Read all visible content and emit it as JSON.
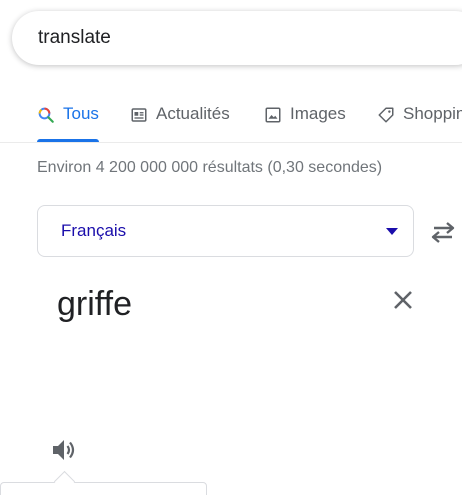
{
  "search": {
    "query": "translate"
  },
  "tabs": [
    {
      "label": "Tous",
      "icon": "search-icon",
      "active": true
    },
    {
      "label": "Actualités",
      "icon": "news-icon",
      "active": false
    },
    {
      "label": "Images",
      "icon": "image-icon",
      "active": false
    },
    {
      "label": "Shopping",
      "icon": "tag-icon",
      "active": false
    }
  ],
  "result_stats": "Environ 4 200 000 000 résultats (0,30 secondes)",
  "translator": {
    "source_language": "Français",
    "source_text": "griffe",
    "icons": {
      "dropdown": "chevron-down-icon",
      "swap": "swap-arrows-icon",
      "clear": "close-icon",
      "speaker": "speaker-icon"
    }
  },
  "colors": {
    "accent_blue": "#1a73e8",
    "link_blue": "#1a0dab",
    "muted_text": "#70757a",
    "tab_text": "#5f6368"
  }
}
